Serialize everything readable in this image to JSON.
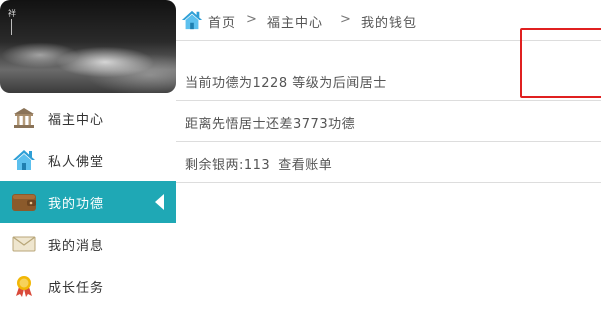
{
  "sidebar": {
    "banner_seal": "祥",
    "items": [
      {
        "label": "福主中心",
        "icon": "temple-icon",
        "active": false
      },
      {
        "label": "私人佛堂",
        "icon": "home-icon",
        "active": false
      },
      {
        "label": "我的功德",
        "icon": "wallet-icon",
        "active": true
      },
      {
        "label": "我的消息",
        "icon": "envelope-icon",
        "active": false
      },
      {
        "label": "成长任务",
        "icon": "medal-icon",
        "active": false
      }
    ]
  },
  "breadcrumb": {
    "home": "首页",
    "separator": ">",
    "center": "福主中心",
    "current": "我的钱包"
  },
  "wallet": {
    "merit_line": "当前功德为1228  等级为后闻居士",
    "next_level_line": "距离先悟居士还差3773功德",
    "balance_label": "剩余银两:113",
    "view_bill_link": "查看账单"
  },
  "colors": {
    "active_nav": "#1fa8b5",
    "highlight": "#e02020",
    "divider": "#dddddd"
  }
}
